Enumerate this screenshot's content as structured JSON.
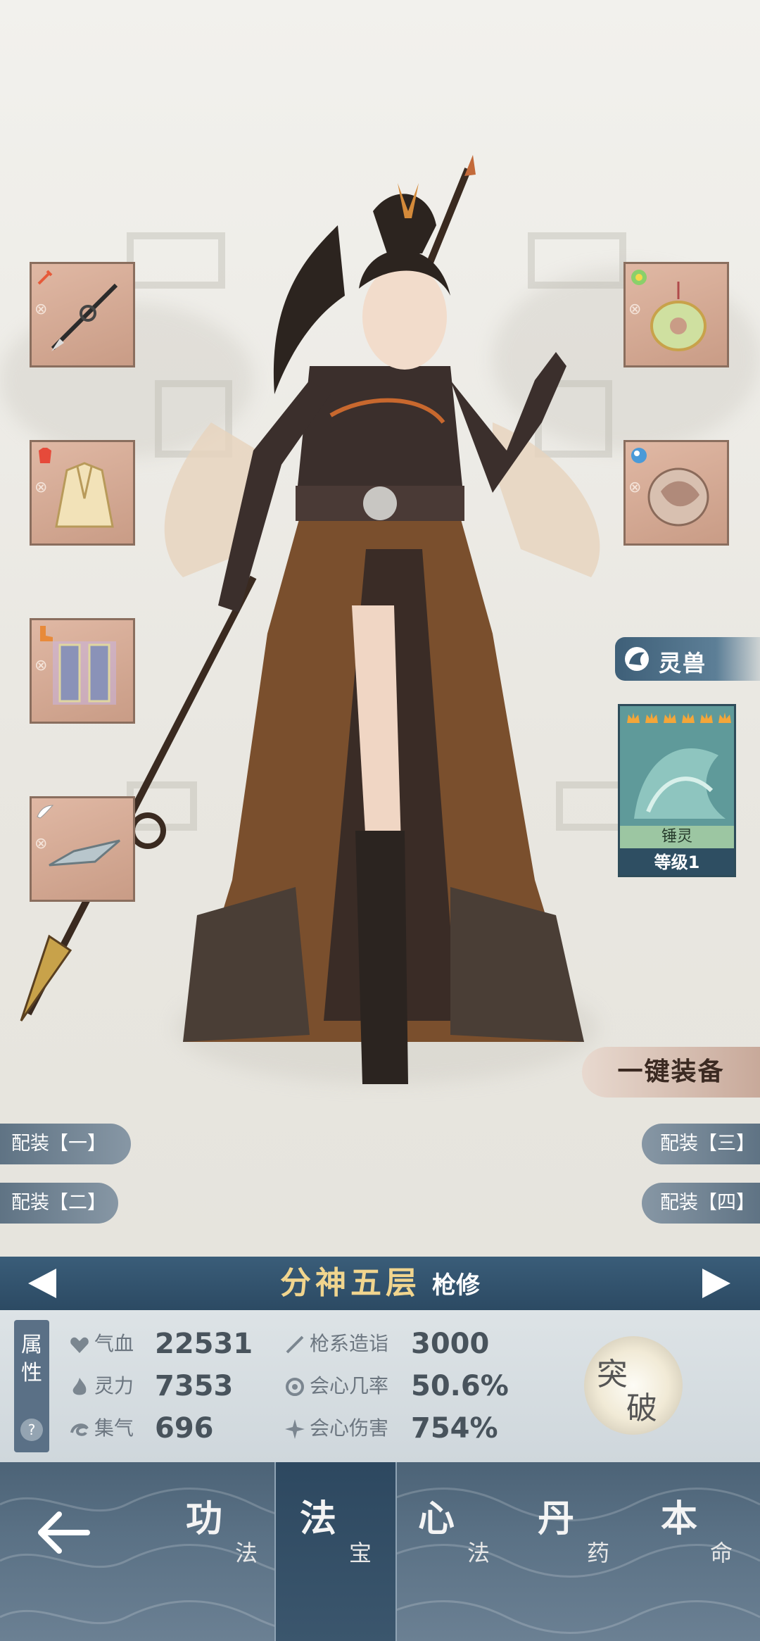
{
  "slots": {
    "left": [
      {
        "icon": "spear-icon",
        "lock": "⊗"
      },
      {
        "icon": "robe-icon",
        "lock": "⊗"
      },
      {
        "icon": "boots-icon",
        "lock": "⊗"
      },
      {
        "icon": "flying-sword-icon",
        "lock": "⊗"
      }
    ],
    "right": [
      {
        "icon": "jade-pendant-icon",
        "lock": "⊗"
      },
      {
        "icon": "beast-talisman-icon",
        "lock": "⊗"
      }
    ]
  },
  "pet": {
    "header": "灵兽",
    "name": "锤灵",
    "level": "等级1",
    "stars": 6
  },
  "equip_all": "一键装备",
  "loadouts": {
    "one": "配装【一】",
    "two": "配装【二】",
    "three": "配装【三】",
    "four": "配装【四】"
  },
  "realm": {
    "title": "分神五层",
    "class": "枪修"
  },
  "attributes": {
    "tab": "属性",
    "help": "?",
    "items": [
      {
        "label": "气血",
        "value": "22531"
      },
      {
        "label": "灵力",
        "value": "7353"
      },
      {
        "label": "集气",
        "value": "696"
      },
      {
        "label": "枪系造诣",
        "value": "3000"
      },
      {
        "label": "会心几率",
        "value": "50.6%"
      },
      {
        "label": "会心伤害",
        "value": "754%"
      }
    ]
  },
  "breakthrough": {
    "c1": "突",
    "c2": "破"
  },
  "nav": {
    "back_icon": "back-arrow-icon",
    "tabs": [
      {
        "c1": "功",
        "c2": "法"
      },
      {
        "c1": "法",
        "c2": "宝",
        "active": true
      },
      {
        "c1": "心",
        "c2": "法"
      },
      {
        "c1": "丹",
        "c2": "药"
      },
      {
        "c1": "本",
        "c2": "命"
      }
    ]
  },
  "colors": {
    "accent_gold": "#f1d58e",
    "bar_blue": "#2c4a63",
    "slot_bg": "#c99c86"
  }
}
